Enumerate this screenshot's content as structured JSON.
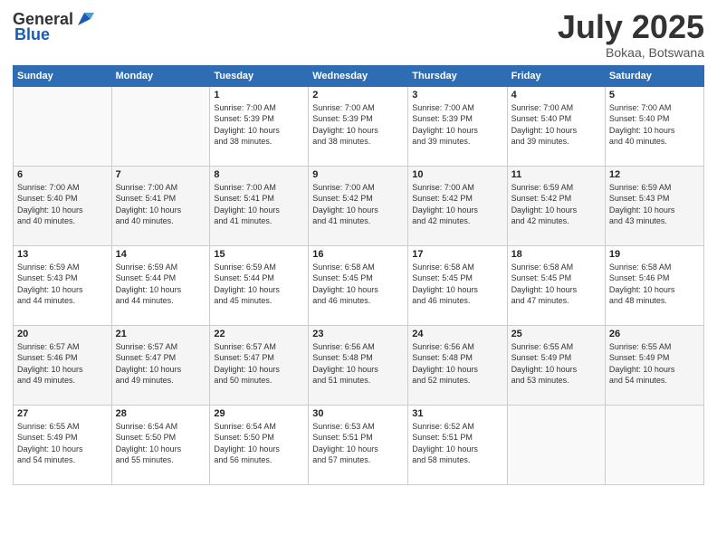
{
  "header": {
    "logo_general": "General",
    "logo_blue": "Blue",
    "month": "July 2025",
    "location": "Bokaa, Botswana"
  },
  "weekdays": [
    "Sunday",
    "Monday",
    "Tuesday",
    "Wednesday",
    "Thursday",
    "Friday",
    "Saturday"
  ],
  "weeks": [
    [
      {
        "day": "",
        "info": ""
      },
      {
        "day": "",
        "info": ""
      },
      {
        "day": "1",
        "info": "Sunrise: 7:00 AM\nSunset: 5:39 PM\nDaylight: 10 hours\nand 38 minutes."
      },
      {
        "day": "2",
        "info": "Sunrise: 7:00 AM\nSunset: 5:39 PM\nDaylight: 10 hours\nand 38 minutes."
      },
      {
        "day": "3",
        "info": "Sunrise: 7:00 AM\nSunset: 5:39 PM\nDaylight: 10 hours\nand 39 minutes."
      },
      {
        "day": "4",
        "info": "Sunrise: 7:00 AM\nSunset: 5:40 PM\nDaylight: 10 hours\nand 39 minutes."
      },
      {
        "day": "5",
        "info": "Sunrise: 7:00 AM\nSunset: 5:40 PM\nDaylight: 10 hours\nand 40 minutes."
      }
    ],
    [
      {
        "day": "6",
        "info": "Sunrise: 7:00 AM\nSunset: 5:40 PM\nDaylight: 10 hours\nand 40 minutes."
      },
      {
        "day": "7",
        "info": "Sunrise: 7:00 AM\nSunset: 5:41 PM\nDaylight: 10 hours\nand 40 minutes."
      },
      {
        "day": "8",
        "info": "Sunrise: 7:00 AM\nSunset: 5:41 PM\nDaylight: 10 hours\nand 41 minutes."
      },
      {
        "day": "9",
        "info": "Sunrise: 7:00 AM\nSunset: 5:42 PM\nDaylight: 10 hours\nand 41 minutes."
      },
      {
        "day": "10",
        "info": "Sunrise: 7:00 AM\nSunset: 5:42 PM\nDaylight: 10 hours\nand 42 minutes."
      },
      {
        "day": "11",
        "info": "Sunrise: 6:59 AM\nSunset: 5:42 PM\nDaylight: 10 hours\nand 42 minutes."
      },
      {
        "day": "12",
        "info": "Sunrise: 6:59 AM\nSunset: 5:43 PM\nDaylight: 10 hours\nand 43 minutes."
      }
    ],
    [
      {
        "day": "13",
        "info": "Sunrise: 6:59 AM\nSunset: 5:43 PM\nDaylight: 10 hours\nand 44 minutes."
      },
      {
        "day": "14",
        "info": "Sunrise: 6:59 AM\nSunset: 5:44 PM\nDaylight: 10 hours\nand 44 minutes."
      },
      {
        "day": "15",
        "info": "Sunrise: 6:59 AM\nSunset: 5:44 PM\nDaylight: 10 hours\nand 45 minutes."
      },
      {
        "day": "16",
        "info": "Sunrise: 6:58 AM\nSunset: 5:45 PM\nDaylight: 10 hours\nand 46 minutes."
      },
      {
        "day": "17",
        "info": "Sunrise: 6:58 AM\nSunset: 5:45 PM\nDaylight: 10 hours\nand 46 minutes."
      },
      {
        "day": "18",
        "info": "Sunrise: 6:58 AM\nSunset: 5:45 PM\nDaylight: 10 hours\nand 47 minutes."
      },
      {
        "day": "19",
        "info": "Sunrise: 6:58 AM\nSunset: 5:46 PM\nDaylight: 10 hours\nand 48 minutes."
      }
    ],
    [
      {
        "day": "20",
        "info": "Sunrise: 6:57 AM\nSunset: 5:46 PM\nDaylight: 10 hours\nand 49 minutes."
      },
      {
        "day": "21",
        "info": "Sunrise: 6:57 AM\nSunset: 5:47 PM\nDaylight: 10 hours\nand 49 minutes."
      },
      {
        "day": "22",
        "info": "Sunrise: 6:57 AM\nSunset: 5:47 PM\nDaylight: 10 hours\nand 50 minutes."
      },
      {
        "day": "23",
        "info": "Sunrise: 6:56 AM\nSunset: 5:48 PM\nDaylight: 10 hours\nand 51 minutes."
      },
      {
        "day": "24",
        "info": "Sunrise: 6:56 AM\nSunset: 5:48 PM\nDaylight: 10 hours\nand 52 minutes."
      },
      {
        "day": "25",
        "info": "Sunrise: 6:55 AM\nSunset: 5:49 PM\nDaylight: 10 hours\nand 53 minutes."
      },
      {
        "day": "26",
        "info": "Sunrise: 6:55 AM\nSunset: 5:49 PM\nDaylight: 10 hours\nand 54 minutes."
      }
    ],
    [
      {
        "day": "27",
        "info": "Sunrise: 6:55 AM\nSunset: 5:49 PM\nDaylight: 10 hours\nand 54 minutes."
      },
      {
        "day": "28",
        "info": "Sunrise: 6:54 AM\nSunset: 5:50 PM\nDaylight: 10 hours\nand 55 minutes."
      },
      {
        "day": "29",
        "info": "Sunrise: 6:54 AM\nSunset: 5:50 PM\nDaylight: 10 hours\nand 56 minutes."
      },
      {
        "day": "30",
        "info": "Sunrise: 6:53 AM\nSunset: 5:51 PM\nDaylight: 10 hours\nand 57 minutes."
      },
      {
        "day": "31",
        "info": "Sunrise: 6:52 AM\nSunset: 5:51 PM\nDaylight: 10 hours\nand 58 minutes."
      },
      {
        "day": "",
        "info": ""
      },
      {
        "day": "",
        "info": ""
      }
    ]
  ]
}
